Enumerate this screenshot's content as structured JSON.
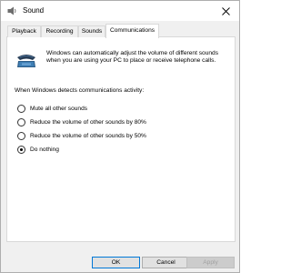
{
  "window": {
    "title": "Sound",
    "close_glyph": "✕",
    "icon": "speaker-icon"
  },
  "tabs": [
    {
      "label": "Playback"
    },
    {
      "label": "Recording"
    },
    {
      "label": "Sounds"
    },
    {
      "label": "Communications",
      "selected": true
    }
  ],
  "communications": {
    "icon": "telephone-icon",
    "intro": "Windows can automatically adjust the volume of different sounds when you are using your PC to place or receive telephone calls.",
    "detect_label": "When Windows detects communications activity:",
    "options": [
      {
        "label": "Mute all other sounds",
        "checked": false
      },
      {
        "label": "Reduce the volume of other sounds by 80%",
        "checked": false
      },
      {
        "label": "Reduce the volume of other sounds by 50%",
        "checked": false
      },
      {
        "label": "Do nothing",
        "checked": true
      }
    ]
  },
  "buttons": {
    "ok": "OK",
    "cancel": "Cancel",
    "apply": "Apply"
  },
  "colors": {
    "accent": "#0078d7",
    "dialog_bg": "#f0f0f0",
    "panel_bg": "#ffffff"
  }
}
